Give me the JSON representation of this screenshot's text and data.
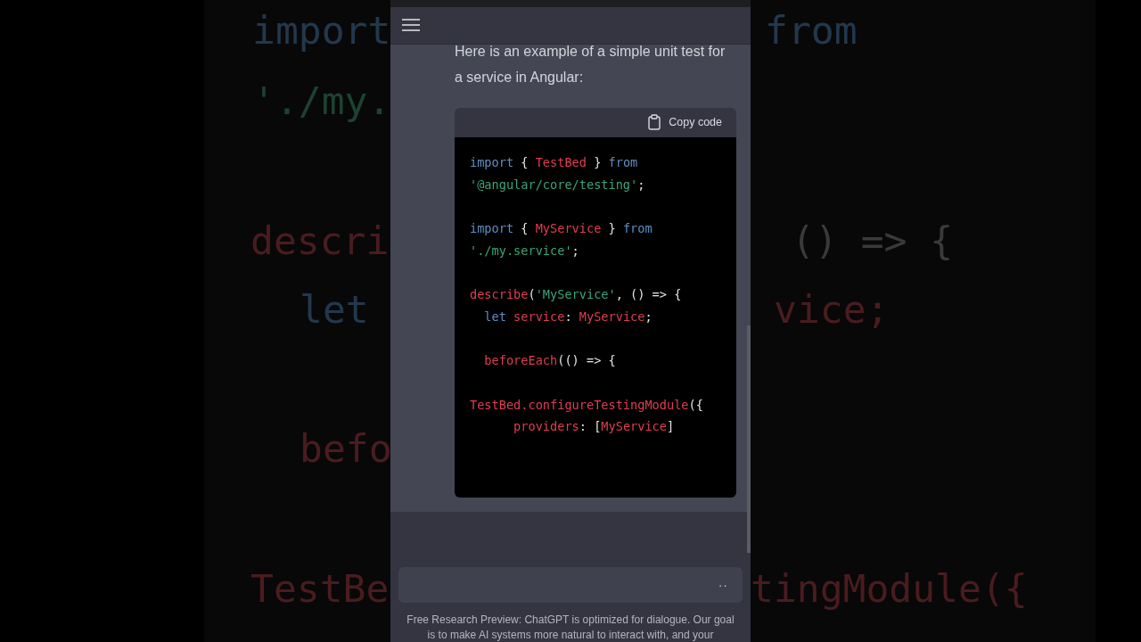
{
  "backdrop": [
    {
      "text": "import",
      "kind": "keyword"
    },
    {
      "text": "from",
      "kind": "keyword"
    },
    {
      "text": "'./my.",
      "kind": "string"
    },
    {
      "text": "descri",
      "kind": "ident"
    },
    {
      "text": "() => {",
      "kind": "punct"
    },
    {
      "text": "let",
      "kind": "keyword"
    },
    {
      "text": "vice;",
      "kind": "ident"
    },
    {
      "text": "befo",
      "kind": "ident"
    },
    {
      "text": "TestBe",
      "kind": "ident"
    },
    {
      "text": "tingModule({",
      "kind": "ident"
    }
  ],
  "message": {
    "text": "Here is an example of a simple unit test for a service in Angular:",
    "code": {
      "copy_label": "Copy code",
      "blocks": [
        [
          [
            {
              "t": "import",
              "kind": "keyword"
            },
            {
              "t": " { ",
              "kind": "punct"
            },
            {
              "t": "TestBed",
              "kind": "ident"
            },
            {
              "t": " } ",
              "kind": "punct"
            },
            {
              "t": "from",
              "kind": "keyword"
            }
          ],
          [
            {
              "t": "'@angular/core/testing'",
              "kind": "string"
            },
            {
              "t": ";",
              "kind": "punct"
            }
          ]
        ],
        [
          [
            {
              "t": "import",
              "kind": "keyword"
            },
            {
              "t": " { ",
              "kind": "punct"
            },
            {
              "t": "MyService",
              "kind": "ident"
            },
            {
              "t": " } ",
              "kind": "punct"
            },
            {
              "t": "from",
              "kind": "keyword"
            }
          ],
          [
            {
              "t": "'./my.service'",
              "kind": "string"
            },
            {
              "t": ";",
              "kind": "punct"
            }
          ]
        ],
        [
          [
            {
              "t": "describe",
              "kind": "ident"
            },
            {
              "t": "(",
              "kind": "punct"
            },
            {
              "t": "'MyService'",
              "kind": "string"
            },
            {
              "t": ", () => {",
              "kind": "punct"
            }
          ],
          [
            {
              "t": "  let",
              "kind": "keyword"
            },
            {
              "t": " service",
              "kind": "ident"
            },
            {
              "t": ": ",
              "kind": "punct"
            },
            {
              "t": "MyService",
              "kind": "ident"
            },
            {
              "t": ";",
              "kind": "punct"
            }
          ]
        ],
        [
          [
            {
              "t": "  beforeEach",
              "kind": "ident"
            },
            {
              "t": "(() => {",
              "kind": "punct"
            }
          ]
        ],
        [
          [
            {
              "t": "TestBed.configureTestingModule",
              "kind": "ident"
            },
            {
              "t": "({",
              "kind": "punct"
            }
          ],
          [
            {
              "t": "      providers",
              "kind": "ident"
            },
            {
              "t": ": [",
              "kind": "punct"
            },
            {
              "t": "MyService",
              "kind": "ident"
            },
            {
              "t": "]",
              "kind": "punct"
            }
          ]
        ]
      ]
    }
  },
  "input": {
    "dots": "··"
  },
  "footer": "Free Research Preview: ChatGPT is optimized for dialogue. Our goal is to make AI systems more natural to interact with, and your"
}
